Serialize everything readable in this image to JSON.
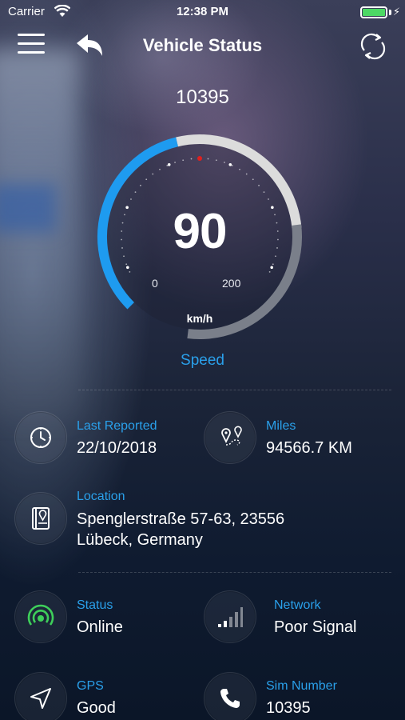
{
  "status_bar": {
    "carrier": "Carrier",
    "time": "12:38 PM"
  },
  "header": {
    "title": "Vehicle Status"
  },
  "vehicle": {
    "id": "10395"
  },
  "speedometer": {
    "value": "90",
    "min_label": "0",
    "max_label": "200",
    "unit": "km/h",
    "caption": "Speed",
    "fill_fraction": 0.45,
    "colors": {
      "fill": "#1e9bf0",
      "track": "#dcdcdc",
      "track_dark": "#7a7f8a",
      "label": "#2aa0ea"
    }
  },
  "info": {
    "last_reported": {
      "label": "Last Reported",
      "value": "22/10/2018",
      "icon": "clock-icon"
    },
    "miles": {
      "label": "Miles",
      "value": "94566.7 KM",
      "icon": "route-icon"
    },
    "location": {
      "label": "Location",
      "line1": "Spenglerstraße 57-63, 23556",
      "line2": "Lübeck, Germany",
      "icon": "address-book-icon"
    },
    "status": {
      "label": "Status",
      "value": "Online",
      "icon": "online-signal-icon",
      "color": "#3ecf5a"
    },
    "network": {
      "label": "Network",
      "value": "Poor Signal",
      "icon": "signal-bars-icon"
    },
    "gps": {
      "label": "GPS",
      "value": "Good",
      "icon": "navigation-arrow-icon"
    },
    "sim": {
      "label": "Sim Number",
      "value": "10395",
      "icon": "phone-icon"
    }
  }
}
